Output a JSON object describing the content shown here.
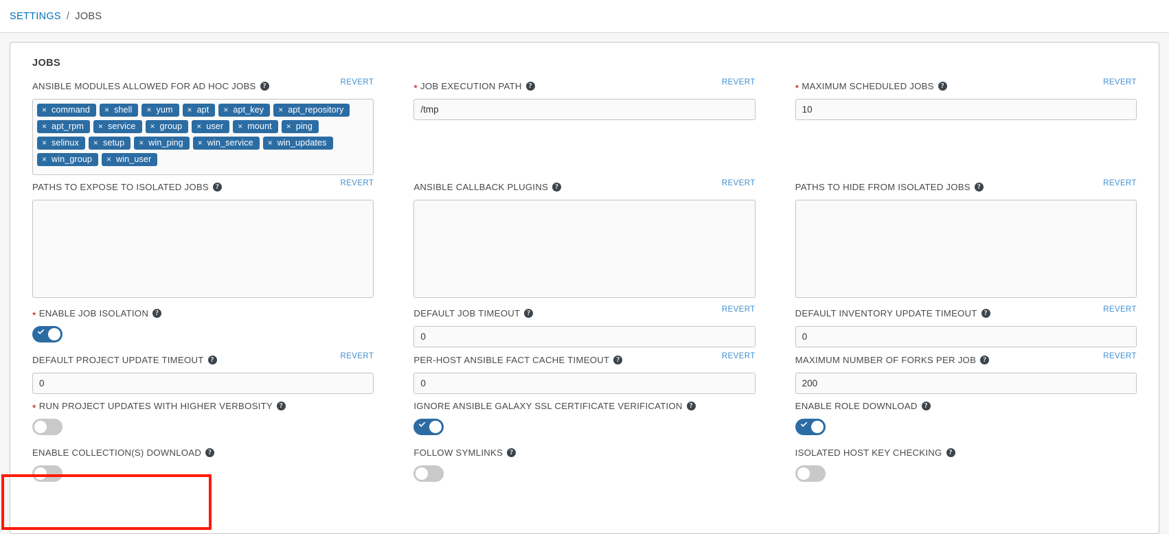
{
  "breadcrumb": {
    "root": "SETTINGS",
    "separator": "/",
    "current": "JOBS"
  },
  "card": {
    "title": "JOBS"
  },
  "common": {
    "revert_label": "REVERT",
    "help_glyph": "?",
    "required_marker": "*",
    "chip_remove_glyph": "×"
  },
  "colors": {
    "accent_blue": "#2b6ca3",
    "link_blue": "#0073b7",
    "revert_blue": "#3f8fd2",
    "required_red": "#cc0000",
    "highlight_red": "#ff1a00",
    "toggle_off_gray": "#c9c9c9"
  },
  "fields": {
    "ansible_modules": {
      "label": "ANSIBLE MODULES ALLOWED FOR AD HOC JOBS",
      "required": false,
      "chips": [
        "command",
        "shell",
        "yum",
        "apt",
        "apt_key",
        "apt_repository",
        "apt_rpm",
        "service",
        "group",
        "user",
        "mount",
        "ping",
        "selinux",
        "setup",
        "win_ping",
        "win_service",
        "win_updates",
        "win_group",
        "win_user"
      ]
    },
    "job_execution_path": {
      "label": "JOB EXECUTION PATH",
      "required": true,
      "value": "/tmp"
    },
    "maximum_scheduled_jobs": {
      "label": "MAXIMUM SCHEDULED JOBS",
      "required": true,
      "value": "10"
    },
    "paths_expose_isolated": {
      "label": "PATHS TO EXPOSE TO ISOLATED JOBS",
      "required": false,
      "value": ""
    },
    "ansible_callback_plugins": {
      "label": "ANSIBLE CALLBACK PLUGINS",
      "required": false,
      "value": ""
    },
    "paths_hide_isolated": {
      "label": "PATHS TO HIDE FROM ISOLATED JOBS",
      "required": false,
      "value": ""
    },
    "enable_job_isolation": {
      "label": "ENABLE JOB ISOLATION",
      "required": true,
      "state": "on"
    },
    "default_job_timeout": {
      "label": "DEFAULT JOB TIMEOUT",
      "required": false,
      "value": "0"
    },
    "default_inventory_update_timeout": {
      "label": "DEFAULT INVENTORY UPDATE TIMEOUT",
      "required": false,
      "value": "0"
    },
    "default_project_update_timeout": {
      "label": "DEFAULT PROJECT UPDATE TIMEOUT",
      "required": false,
      "value": "0"
    },
    "per_host_fact_cache_timeout": {
      "label": "PER-HOST ANSIBLE FACT CACHE TIMEOUT",
      "required": false,
      "value": "0"
    },
    "maximum_forks_per_job": {
      "label": "MAXIMUM NUMBER OF FORKS PER JOB",
      "required": false,
      "value": "200"
    },
    "run_project_updates_verbosity": {
      "label": "RUN PROJECT UPDATES WITH HIGHER VERBOSITY",
      "required": true,
      "state": "off"
    },
    "ignore_galaxy_ssl": {
      "label": "IGNORE ANSIBLE GALAXY SSL CERTIFICATE VERIFICATION",
      "required": false,
      "state": "on"
    },
    "enable_role_download": {
      "label": "ENABLE ROLE DOWNLOAD",
      "required": false,
      "state": "on"
    },
    "enable_collections_download": {
      "label": "ENABLE COLLECTION(S) DOWNLOAD",
      "required": false,
      "state": "off",
      "highlighted": true
    },
    "follow_symlinks": {
      "label": "FOLLOW SYMLINKS",
      "required": false,
      "state": "off"
    },
    "isolated_host_key_checking": {
      "label": "ISOLATED HOST KEY CHECKING",
      "required": false,
      "state": "off"
    }
  }
}
